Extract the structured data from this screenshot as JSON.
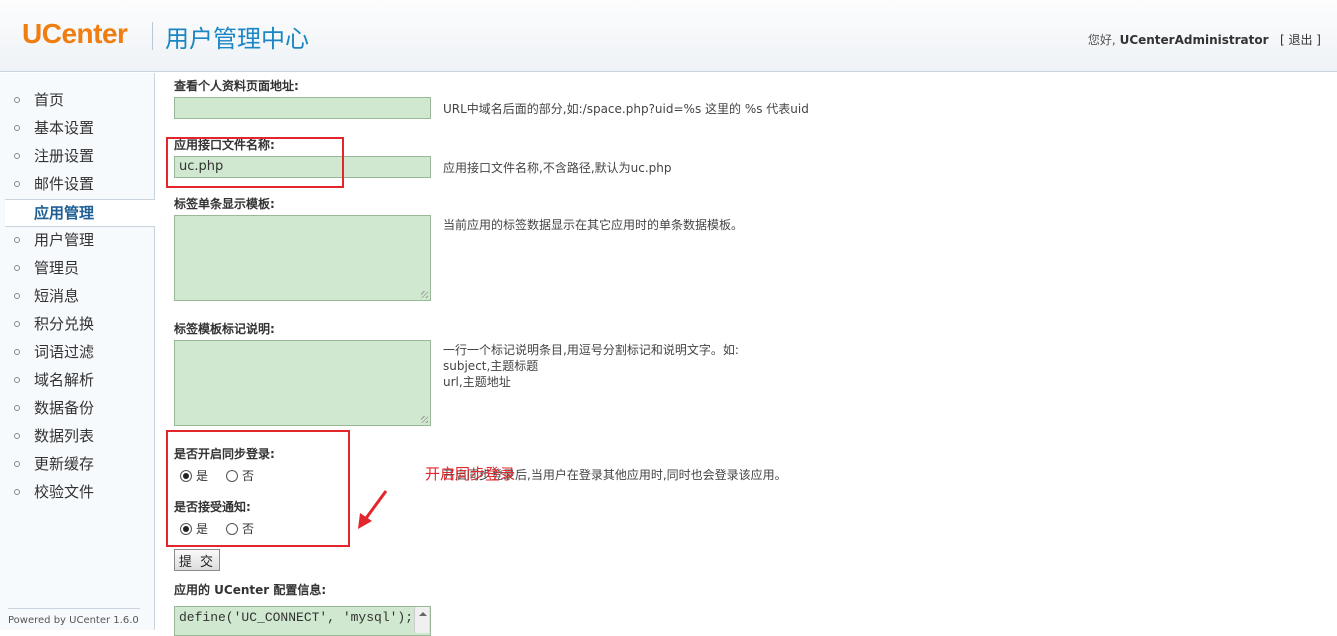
{
  "header": {
    "logo": "UCenter",
    "title": "用户管理中心",
    "greeting": "您好,",
    "username": "UCenterAdministrator",
    "logout_label": "[ 退出 ]"
  },
  "sidebar": {
    "items": [
      {
        "label": "首页"
      },
      {
        "label": "基本设置"
      },
      {
        "label": "注册设置"
      },
      {
        "label": "邮件设置"
      },
      {
        "label": "应用管理"
      },
      {
        "label": "用户管理"
      },
      {
        "label": "管理员"
      },
      {
        "label": "短消息"
      },
      {
        "label": "积分兑换"
      },
      {
        "label": "词语过滤"
      },
      {
        "label": "域名解析"
      },
      {
        "label": "数据备份"
      },
      {
        "label": "数据列表"
      },
      {
        "label": "更新缓存"
      },
      {
        "label": "校验文件"
      }
    ],
    "active_index": 4,
    "powered_by": "Powered by UCenter 1.6.0"
  },
  "form": {
    "profile_url": {
      "label": "查看个人资料页面地址:",
      "value": "",
      "hint": "URL中域名后面的部分,如:/space.php?uid=%s 这里的 %s 代表uid"
    },
    "api_file": {
      "label": "应用接口文件名称:",
      "value": "uc.php",
      "hint": "应用接口文件名称,不含路径,默认为uc.php"
    },
    "tag_template": {
      "label": "标签单条显示模板:",
      "value": "",
      "hint": "当前应用的标签数据显示在其它应用时的单条数据模板。"
    },
    "tag_fields": {
      "label": "标签模板标记说明:",
      "value": "",
      "hint_line1": "一行一个标记说明条目,用逗号分割标记和说明文字。如:",
      "hint_line2": "subject,主题标题",
      "hint_line3": "url,主题地址"
    },
    "synlogin": {
      "label": "是否开启同步登录:",
      "yes": "是",
      "no": "否",
      "selected": "是",
      "hint": "开启同步登录后,当用户在登录其他应用时,同时也会登录该应用。"
    },
    "recvnote": {
      "label": "是否接受通知:",
      "yes": "是",
      "no": "否",
      "selected": "是"
    },
    "submit_label": "提 交",
    "config": {
      "label": "应用的 UCenter 配置信息:",
      "line1": "define('UC_CONNECT', 'mysql');"
    }
  },
  "annotation": {
    "text": "开启同步登录",
    "color": "#e3262b"
  }
}
